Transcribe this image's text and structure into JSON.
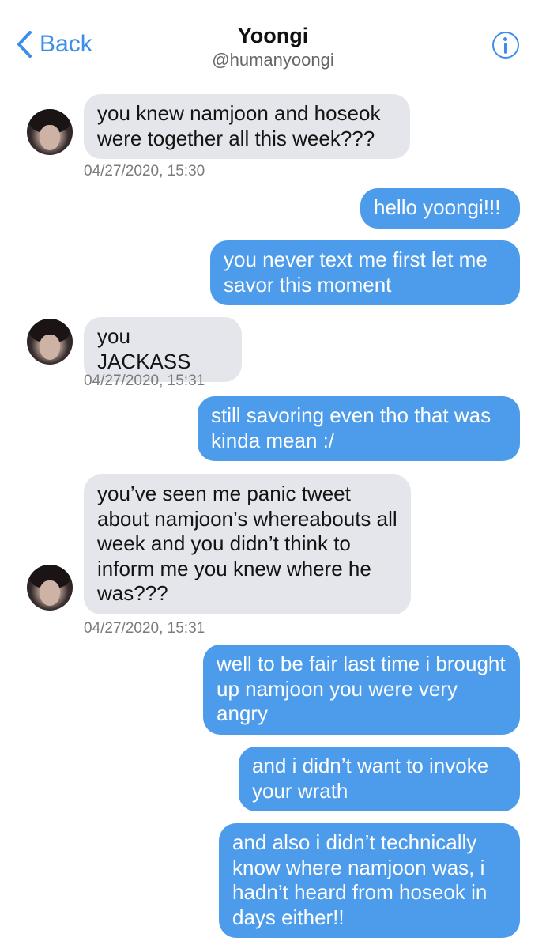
{
  "header": {
    "back_label": "Back",
    "title": "Yoongi",
    "handle": "@humanyoongi"
  },
  "messages": [
    {
      "text": "you knew namjoon and hoseok were together all this week???"
    },
    {
      "text": "hello yoongi!!!"
    },
    {
      "text": "you never text me first let me savor this moment"
    },
    {
      "text": "you JACKASS"
    },
    {
      "text": "still savoring even tho that was kinda mean :/"
    },
    {
      "text": "you’ve seen me panic tweet about namjoon’s whereabouts all week and you didn’t think to inform me you knew where he was???"
    },
    {
      "text": "well to be fair last time i brought up namjoon you were very angry"
    },
    {
      "text": "and i didn’t want to invoke your wrath"
    },
    {
      "text": "and also i didn’t technically know where namjoon was, i hadn’t heard from hoseok in days either!!"
    }
  ],
  "timestamps": [
    "04/27/2020, 15:30",
    "04/27/2020, 15:31",
    "04/27/2020, 15:31"
  ],
  "colors": {
    "accent": "#3d8ee8",
    "incoming_bubble": "#e5e6eb",
    "outgoing_bubble": "#4d9ceb"
  }
}
